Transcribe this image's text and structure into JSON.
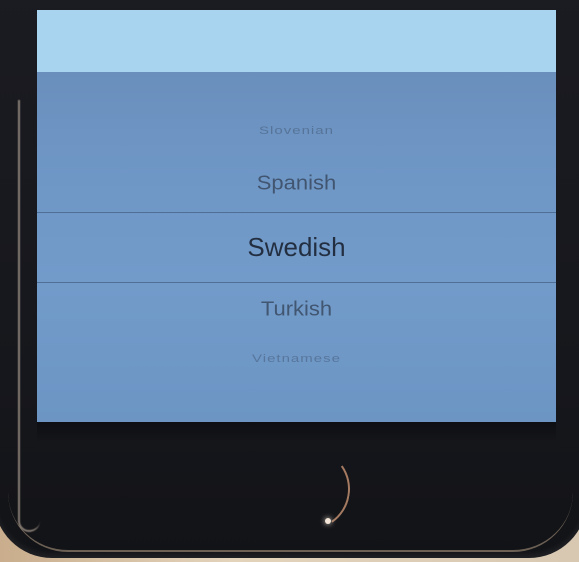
{
  "language_picker": {
    "items": [
      "Slovenian",
      "Spanish",
      "Swedish",
      "Turkish",
      "Vietnamese"
    ],
    "selected": "Swedish"
  },
  "colors": {
    "screen_top": "#a9d4f0",
    "picker_background": "#6f99c9",
    "phone_body": "#16171c"
  }
}
